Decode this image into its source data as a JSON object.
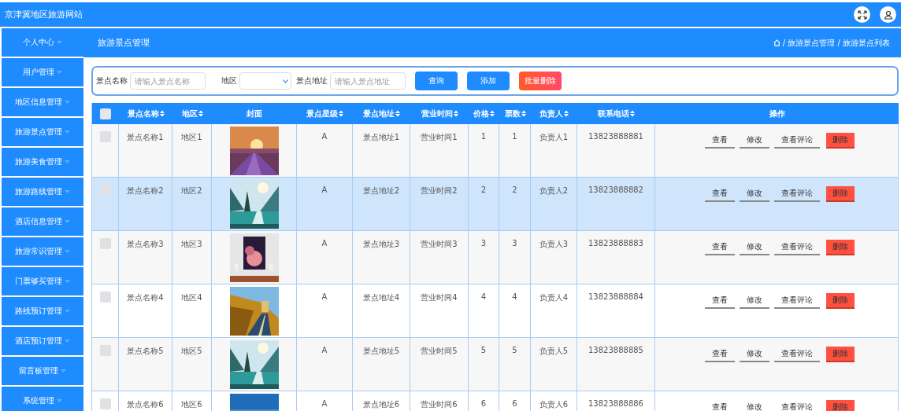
{
  "site_title": "京津冀地区旅游网站",
  "sidebar": {
    "items": [
      {
        "label": "个人中心"
      },
      {
        "label": "用户管理"
      },
      {
        "label": "地区信息管理"
      },
      {
        "label": "旅游景点管理"
      },
      {
        "label": "旅游美食管理"
      },
      {
        "label": "旅游路线管理"
      },
      {
        "label": "酒店信息管理"
      },
      {
        "label": "旅游常识管理"
      },
      {
        "label": "门票够买管理"
      },
      {
        "label": "路线预订管理"
      },
      {
        "label": "酒店预订管理"
      },
      {
        "label": "留言板管理"
      },
      {
        "label": "系统管理"
      }
    ]
  },
  "header": {
    "title": "旅游景点管理",
    "breadcrumb": "/ 旅游景点管理 / 旅游景点列表"
  },
  "search": {
    "fields": [
      {
        "label": "景点名称",
        "kind": "input",
        "placeholder": "请输入景点名称"
      },
      {
        "label": "地区",
        "kind": "select"
      },
      {
        "label": "景点地址",
        "kind": "input",
        "placeholder": "请输入景点地址"
      }
    ],
    "buttons": [
      {
        "label": "查询",
        "kind": "primary"
      },
      {
        "label": "添加",
        "kind": "primary"
      },
      {
        "label": "批量删除",
        "kind": "danger"
      }
    ]
  },
  "table": {
    "header_checked": false,
    "columns": [
      {
        "label": "景点名称",
        "sortable": true
      },
      {
        "label": "地区",
        "sortable": true
      },
      {
        "label": "封面",
        "sortable": false
      },
      {
        "label": "景点星级",
        "sortable": true
      },
      {
        "label": "景点地址",
        "sortable": true
      },
      {
        "label": "营业时间",
        "sortable": true
      },
      {
        "label": "价格",
        "sortable": true
      },
      {
        "label": "票数",
        "sortable": true
      },
      {
        "label": "负责人",
        "sortable": true
      },
      {
        "label": "联系电话",
        "sortable": true
      },
      {
        "label": "操作",
        "sortable": false
      }
    ],
    "rows": [
      {
        "selected": false,
        "checked": false,
        "name": "景点名称1",
        "area": "地区1",
        "star": "A",
        "address": "景点地址1",
        "hours": "营业时间1",
        "price": "1",
        "tickets": "1",
        "person": "负责人1",
        "phone": "13823888881",
        "actions": [
          {
            "label": "查看",
            "kind": "link"
          },
          {
            "label": "修改",
            "kind": "link"
          },
          {
            "label": "查看评论",
            "kind": "link"
          },
          {
            "label": "删除",
            "kind": "danger"
          }
        ]
      },
      {
        "selected": true,
        "checked": false,
        "name": "景点名称2",
        "area": "地区2",
        "star": "A",
        "address": "景点地址2",
        "hours": "营业时间2",
        "price": "2",
        "tickets": "2",
        "person": "负责人2",
        "phone": "13823888882",
        "actions": [
          {
            "label": "查看",
            "kind": "link"
          },
          {
            "label": "修改",
            "kind": "link"
          },
          {
            "label": "查看评论",
            "kind": "link"
          },
          {
            "label": "删除",
            "kind": "danger"
          }
        ]
      },
      {
        "selected": false,
        "checked": false,
        "name": "景点名称3",
        "area": "地区3",
        "star": "A",
        "address": "景点地址3",
        "hours": "营业时间3",
        "price": "3",
        "tickets": "3",
        "person": "负责人3",
        "phone": "13823888883",
        "actions": [
          {
            "label": "查看",
            "kind": "link"
          },
          {
            "label": "修改",
            "kind": "link"
          },
          {
            "label": "查看评论",
            "kind": "link"
          },
          {
            "label": "删除",
            "kind": "danger"
          }
        ]
      },
      {
        "selected": false,
        "checked": false,
        "name": "景点名称4",
        "area": "地区4",
        "star": "A",
        "address": "景点地址4",
        "hours": "营业时间4",
        "price": "4",
        "tickets": "4",
        "person": "负责人4",
        "phone": "13823888884",
        "actions": [
          {
            "label": "查看",
            "kind": "link"
          },
          {
            "label": "修改",
            "kind": "link"
          },
          {
            "label": "查看评论",
            "kind": "link"
          },
          {
            "label": "删除",
            "kind": "danger"
          }
        ]
      },
      {
        "selected": false,
        "checked": false,
        "name": "景点名称5",
        "area": "地区5",
        "star": "A",
        "address": "景点地址5",
        "hours": "营业时间5",
        "price": "5",
        "tickets": "5",
        "person": "负责人5",
        "phone": "13823888885",
        "actions": [
          {
            "label": "查看",
            "kind": "link"
          },
          {
            "label": "修改",
            "kind": "link"
          },
          {
            "label": "查看评论",
            "kind": "link"
          },
          {
            "label": "删除",
            "kind": "danger"
          }
        ]
      },
      {
        "selected": false,
        "checked": false,
        "name": "景点名称6",
        "area": "地区6",
        "star": "A",
        "address": "景点地址6",
        "hours": "营业时间6",
        "price": "6",
        "tickets": "6",
        "person": "负责人6",
        "phone": "13823888886",
        "actions": [
          {
            "label": "查看",
            "kind": "link"
          },
          {
            "label": "修改",
            "kind": "link"
          },
          {
            "label": "查看评论",
            "kind": "link"
          },
          {
            "label": "删除",
            "kind": "danger"
          }
        ]
      }
    ]
  }
}
